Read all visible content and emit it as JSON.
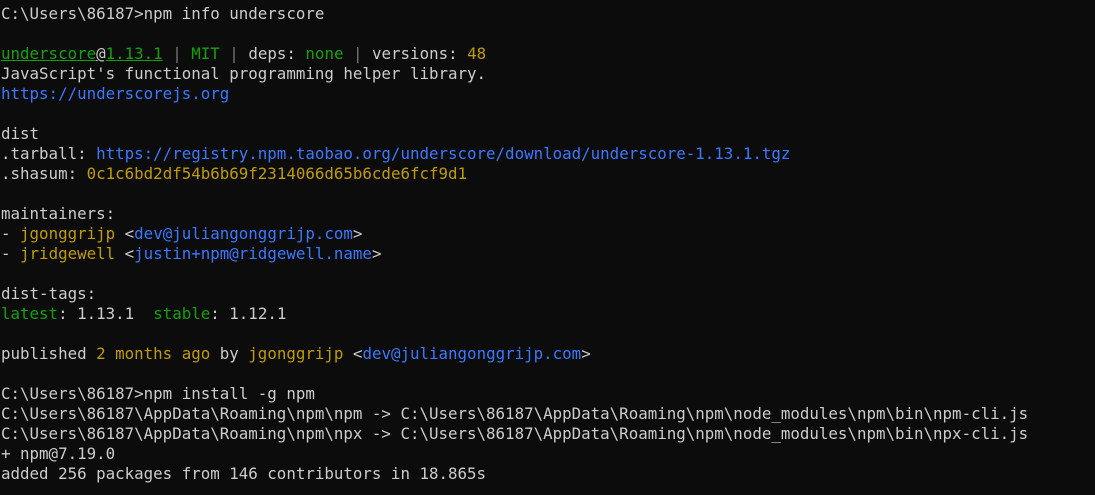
{
  "terminal": {
    "lines": [
      {
        "segments": [
          {
            "text": "C:\\Users\\86187>npm info underscore",
            "color": "default"
          }
        ]
      },
      {
        "segments": []
      },
      {
        "segments": [
          {
            "text": "underscore",
            "color": "green",
            "underline": true
          },
          {
            "text": "@",
            "color": "default",
            "underline": true
          },
          {
            "text": "1.13.1",
            "color": "green",
            "underline": true
          },
          {
            "text": " | ",
            "color": "gray"
          },
          {
            "text": "MIT",
            "color": "green"
          },
          {
            "text": " | ",
            "color": "gray"
          },
          {
            "text": "deps: ",
            "color": "default"
          },
          {
            "text": "none",
            "color": "green"
          },
          {
            "text": " | ",
            "color": "gray"
          },
          {
            "text": "versions: ",
            "color": "default"
          },
          {
            "text": "48",
            "color": "yellow"
          }
        ]
      },
      {
        "segments": [
          {
            "text": "JavaScript's functional programming helper library.",
            "color": "default"
          }
        ]
      },
      {
        "segments": [
          {
            "text": "https://underscorejs.org",
            "color": "blue"
          }
        ]
      },
      {
        "segments": []
      },
      {
        "segments": [
          {
            "text": "dist",
            "color": "default"
          }
        ]
      },
      {
        "segments": [
          {
            "text": ".tarball: ",
            "color": "default"
          },
          {
            "text": "https://registry.npm.taobao.org/underscore/download/underscore-1.13.1.tgz",
            "color": "blue"
          }
        ]
      },
      {
        "segments": [
          {
            "text": ".shasum: ",
            "color": "default"
          },
          {
            "text": "0c1c6bd2df54b6b69f2314066d65b6cde6fcf9d1",
            "color": "yellow"
          }
        ]
      },
      {
        "segments": []
      },
      {
        "segments": [
          {
            "text": "maintainers:",
            "color": "default"
          }
        ]
      },
      {
        "segments": [
          {
            "text": "- ",
            "color": "default"
          },
          {
            "text": "jgonggrijp",
            "color": "yellow"
          },
          {
            "text": " <",
            "color": "default"
          },
          {
            "text": "dev@juliangonggrijp.com",
            "color": "blue"
          },
          {
            "text": ">",
            "color": "default"
          }
        ]
      },
      {
        "segments": [
          {
            "text": "- ",
            "color": "default"
          },
          {
            "text": "jridgewell",
            "color": "yellow"
          },
          {
            "text": " <",
            "color": "default"
          },
          {
            "text": "justin+npm@ridgewell.name",
            "color": "blue"
          },
          {
            "text": ">",
            "color": "default"
          }
        ]
      },
      {
        "segments": []
      },
      {
        "segments": [
          {
            "text": "dist-tags:",
            "color": "default"
          }
        ]
      },
      {
        "segments": [
          {
            "text": "latest",
            "color": "green"
          },
          {
            "text": ": 1.13.1  ",
            "color": "default"
          },
          {
            "text": "stable",
            "color": "green"
          },
          {
            "text": ": 1.12.1",
            "color": "default"
          }
        ]
      },
      {
        "segments": []
      },
      {
        "segments": [
          {
            "text": "published ",
            "color": "default"
          },
          {
            "text": "2 months ago",
            "color": "yellow"
          },
          {
            "text": " by ",
            "color": "default"
          },
          {
            "text": "jgonggrijp",
            "color": "yellow"
          },
          {
            "text": " <",
            "color": "default"
          },
          {
            "text": "dev@juliangonggrijp.com",
            "color": "blue"
          },
          {
            "text": ">",
            "color": "default"
          }
        ]
      },
      {
        "segments": []
      },
      {
        "segments": [
          {
            "text": "C:\\Users\\86187>npm install -g npm",
            "color": "default"
          }
        ]
      },
      {
        "segments": [
          {
            "text": "C:\\Users\\86187\\AppData\\Roaming\\npm\\npm -> C:\\Users\\86187\\AppData\\Roaming\\npm\\node_modules\\npm\\bin\\npm-cli.js",
            "color": "default"
          }
        ]
      },
      {
        "segments": [
          {
            "text": "C:\\Users\\86187\\AppData\\Roaming\\npm\\npx -> C:\\Users\\86187\\AppData\\Roaming\\npm\\node_modules\\npm\\bin\\npx-cli.js",
            "color": "default"
          }
        ]
      },
      {
        "segments": [
          {
            "text": "+ npm@7.19.0",
            "color": "default"
          }
        ]
      },
      {
        "segments": [
          {
            "text": "added 256 packages from 146 contributors in 18.865s",
            "color": "default"
          }
        ]
      }
    ]
  },
  "colors": {
    "background": "#0c0c0c",
    "default": "#cccccc",
    "green": "#13a10e",
    "blue": "#3b78ff",
    "yellow": "#c19c00",
    "gray": "#767676"
  }
}
